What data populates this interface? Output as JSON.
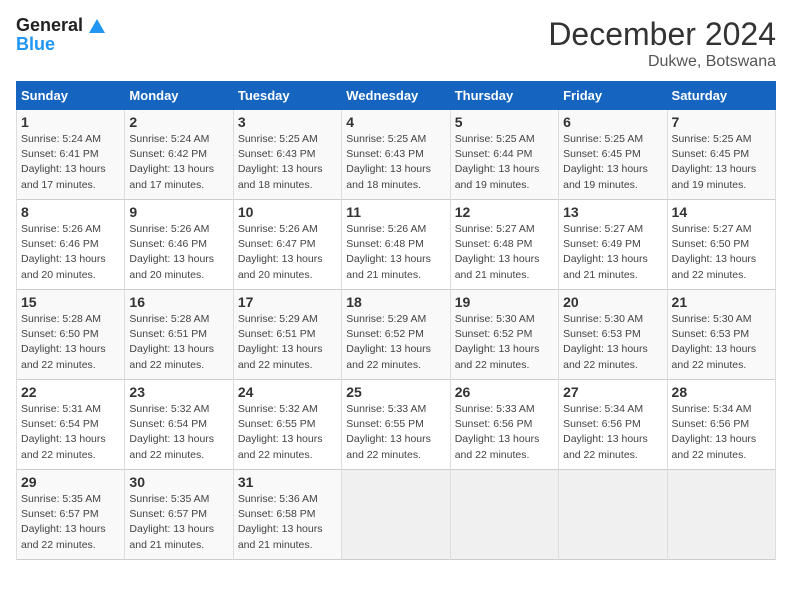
{
  "logo": {
    "line1": "General",
    "line2": "Blue"
  },
  "title": "December 2024",
  "location": "Dukwe, Botswana",
  "days_of_week": [
    "Sunday",
    "Monday",
    "Tuesday",
    "Wednesday",
    "Thursday",
    "Friday",
    "Saturday"
  ],
  "weeks": [
    [
      {
        "day": "1",
        "sunrise": "5:24 AM",
        "sunset": "6:41 PM",
        "daylight": "13 hours and 17 minutes."
      },
      {
        "day": "2",
        "sunrise": "5:24 AM",
        "sunset": "6:42 PM",
        "daylight": "13 hours and 17 minutes."
      },
      {
        "day": "3",
        "sunrise": "5:25 AM",
        "sunset": "6:43 PM",
        "daylight": "13 hours and 18 minutes."
      },
      {
        "day": "4",
        "sunrise": "5:25 AM",
        "sunset": "6:43 PM",
        "daylight": "13 hours and 18 minutes."
      },
      {
        "day": "5",
        "sunrise": "5:25 AM",
        "sunset": "6:44 PM",
        "daylight": "13 hours and 19 minutes."
      },
      {
        "day": "6",
        "sunrise": "5:25 AM",
        "sunset": "6:45 PM",
        "daylight": "13 hours and 19 minutes."
      },
      {
        "day": "7",
        "sunrise": "5:25 AM",
        "sunset": "6:45 PM",
        "daylight": "13 hours and 19 minutes."
      }
    ],
    [
      {
        "day": "8",
        "sunrise": "5:26 AM",
        "sunset": "6:46 PM",
        "daylight": "13 hours and 20 minutes."
      },
      {
        "day": "9",
        "sunrise": "5:26 AM",
        "sunset": "6:46 PM",
        "daylight": "13 hours and 20 minutes."
      },
      {
        "day": "10",
        "sunrise": "5:26 AM",
        "sunset": "6:47 PM",
        "daylight": "13 hours and 20 minutes."
      },
      {
        "day": "11",
        "sunrise": "5:26 AM",
        "sunset": "6:48 PM",
        "daylight": "13 hours and 21 minutes."
      },
      {
        "day": "12",
        "sunrise": "5:27 AM",
        "sunset": "6:48 PM",
        "daylight": "13 hours and 21 minutes."
      },
      {
        "day": "13",
        "sunrise": "5:27 AM",
        "sunset": "6:49 PM",
        "daylight": "13 hours and 21 minutes."
      },
      {
        "day": "14",
        "sunrise": "5:27 AM",
        "sunset": "6:50 PM",
        "daylight": "13 hours and 22 minutes."
      }
    ],
    [
      {
        "day": "15",
        "sunrise": "5:28 AM",
        "sunset": "6:50 PM",
        "daylight": "13 hours and 22 minutes."
      },
      {
        "day": "16",
        "sunrise": "5:28 AM",
        "sunset": "6:51 PM",
        "daylight": "13 hours and 22 minutes."
      },
      {
        "day": "17",
        "sunrise": "5:29 AM",
        "sunset": "6:51 PM",
        "daylight": "13 hours and 22 minutes."
      },
      {
        "day": "18",
        "sunrise": "5:29 AM",
        "sunset": "6:52 PM",
        "daylight": "13 hours and 22 minutes."
      },
      {
        "day": "19",
        "sunrise": "5:30 AM",
        "sunset": "6:52 PM",
        "daylight": "13 hours and 22 minutes."
      },
      {
        "day": "20",
        "sunrise": "5:30 AM",
        "sunset": "6:53 PM",
        "daylight": "13 hours and 22 minutes."
      },
      {
        "day": "21",
        "sunrise": "5:30 AM",
        "sunset": "6:53 PM",
        "daylight": "13 hours and 22 minutes."
      }
    ],
    [
      {
        "day": "22",
        "sunrise": "5:31 AM",
        "sunset": "6:54 PM",
        "daylight": "13 hours and 22 minutes."
      },
      {
        "day": "23",
        "sunrise": "5:32 AM",
        "sunset": "6:54 PM",
        "daylight": "13 hours and 22 minutes."
      },
      {
        "day": "24",
        "sunrise": "5:32 AM",
        "sunset": "6:55 PM",
        "daylight": "13 hours and 22 minutes."
      },
      {
        "day": "25",
        "sunrise": "5:33 AM",
        "sunset": "6:55 PM",
        "daylight": "13 hours and 22 minutes."
      },
      {
        "day": "26",
        "sunrise": "5:33 AM",
        "sunset": "6:56 PM",
        "daylight": "13 hours and 22 minutes."
      },
      {
        "day": "27",
        "sunrise": "5:34 AM",
        "sunset": "6:56 PM",
        "daylight": "13 hours and 22 minutes."
      },
      {
        "day": "28",
        "sunrise": "5:34 AM",
        "sunset": "6:56 PM",
        "daylight": "13 hours and 22 minutes."
      }
    ],
    [
      {
        "day": "29",
        "sunrise": "5:35 AM",
        "sunset": "6:57 PM",
        "daylight": "13 hours and 22 minutes."
      },
      {
        "day": "30",
        "sunrise": "5:35 AM",
        "sunset": "6:57 PM",
        "daylight": "13 hours and 21 minutes."
      },
      {
        "day": "31",
        "sunrise": "5:36 AM",
        "sunset": "6:58 PM",
        "daylight": "13 hours and 21 minutes."
      },
      null,
      null,
      null,
      null
    ]
  ],
  "labels": {
    "sunrise": "Sunrise:",
    "sunset": "Sunset:",
    "daylight": "Daylight:"
  }
}
